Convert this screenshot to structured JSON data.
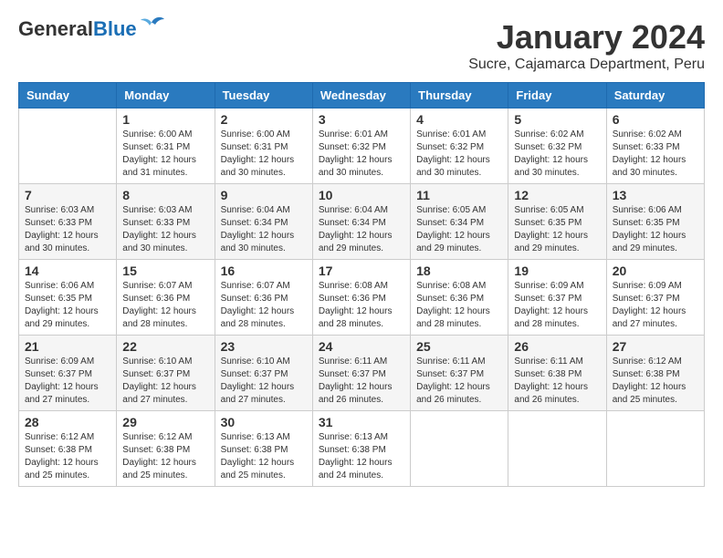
{
  "header": {
    "logo_general": "General",
    "logo_blue": "Blue",
    "month_title": "January 2024",
    "subtitle": "Sucre, Cajamarca Department, Peru"
  },
  "days_of_week": [
    "Sunday",
    "Monday",
    "Tuesday",
    "Wednesday",
    "Thursday",
    "Friday",
    "Saturday"
  ],
  "weeks": [
    [
      {
        "day": "",
        "sunrise": "",
        "sunset": "",
        "daylight": ""
      },
      {
        "day": "1",
        "sunrise": "Sunrise: 6:00 AM",
        "sunset": "Sunset: 6:31 PM",
        "daylight": "Daylight: 12 hours and 31 minutes."
      },
      {
        "day": "2",
        "sunrise": "Sunrise: 6:00 AM",
        "sunset": "Sunset: 6:31 PM",
        "daylight": "Daylight: 12 hours and 30 minutes."
      },
      {
        "day": "3",
        "sunrise": "Sunrise: 6:01 AM",
        "sunset": "Sunset: 6:32 PM",
        "daylight": "Daylight: 12 hours and 30 minutes."
      },
      {
        "day": "4",
        "sunrise": "Sunrise: 6:01 AM",
        "sunset": "Sunset: 6:32 PM",
        "daylight": "Daylight: 12 hours and 30 minutes."
      },
      {
        "day": "5",
        "sunrise": "Sunrise: 6:02 AM",
        "sunset": "Sunset: 6:32 PM",
        "daylight": "Daylight: 12 hours and 30 minutes."
      },
      {
        "day": "6",
        "sunrise": "Sunrise: 6:02 AM",
        "sunset": "Sunset: 6:33 PM",
        "daylight": "Daylight: 12 hours and 30 minutes."
      }
    ],
    [
      {
        "day": "7",
        "sunrise": "Sunrise: 6:03 AM",
        "sunset": "Sunset: 6:33 PM",
        "daylight": "Daylight: 12 hours and 30 minutes."
      },
      {
        "day": "8",
        "sunrise": "Sunrise: 6:03 AM",
        "sunset": "Sunset: 6:33 PM",
        "daylight": "Daylight: 12 hours and 30 minutes."
      },
      {
        "day": "9",
        "sunrise": "Sunrise: 6:04 AM",
        "sunset": "Sunset: 6:34 PM",
        "daylight": "Daylight: 12 hours and 30 minutes."
      },
      {
        "day": "10",
        "sunrise": "Sunrise: 6:04 AM",
        "sunset": "Sunset: 6:34 PM",
        "daylight": "Daylight: 12 hours and 29 minutes."
      },
      {
        "day": "11",
        "sunrise": "Sunrise: 6:05 AM",
        "sunset": "Sunset: 6:34 PM",
        "daylight": "Daylight: 12 hours and 29 minutes."
      },
      {
        "day": "12",
        "sunrise": "Sunrise: 6:05 AM",
        "sunset": "Sunset: 6:35 PM",
        "daylight": "Daylight: 12 hours and 29 minutes."
      },
      {
        "day": "13",
        "sunrise": "Sunrise: 6:06 AM",
        "sunset": "Sunset: 6:35 PM",
        "daylight": "Daylight: 12 hours and 29 minutes."
      }
    ],
    [
      {
        "day": "14",
        "sunrise": "Sunrise: 6:06 AM",
        "sunset": "Sunset: 6:35 PM",
        "daylight": "Daylight: 12 hours and 29 minutes."
      },
      {
        "day": "15",
        "sunrise": "Sunrise: 6:07 AM",
        "sunset": "Sunset: 6:36 PM",
        "daylight": "Daylight: 12 hours and 28 minutes."
      },
      {
        "day": "16",
        "sunrise": "Sunrise: 6:07 AM",
        "sunset": "Sunset: 6:36 PM",
        "daylight": "Daylight: 12 hours and 28 minutes."
      },
      {
        "day": "17",
        "sunrise": "Sunrise: 6:08 AM",
        "sunset": "Sunset: 6:36 PM",
        "daylight": "Daylight: 12 hours and 28 minutes."
      },
      {
        "day": "18",
        "sunrise": "Sunrise: 6:08 AM",
        "sunset": "Sunset: 6:36 PM",
        "daylight": "Daylight: 12 hours and 28 minutes."
      },
      {
        "day": "19",
        "sunrise": "Sunrise: 6:09 AM",
        "sunset": "Sunset: 6:37 PM",
        "daylight": "Daylight: 12 hours and 28 minutes."
      },
      {
        "day": "20",
        "sunrise": "Sunrise: 6:09 AM",
        "sunset": "Sunset: 6:37 PM",
        "daylight": "Daylight: 12 hours and 27 minutes."
      }
    ],
    [
      {
        "day": "21",
        "sunrise": "Sunrise: 6:09 AM",
        "sunset": "Sunset: 6:37 PM",
        "daylight": "Daylight: 12 hours and 27 minutes."
      },
      {
        "day": "22",
        "sunrise": "Sunrise: 6:10 AM",
        "sunset": "Sunset: 6:37 PM",
        "daylight": "Daylight: 12 hours and 27 minutes."
      },
      {
        "day": "23",
        "sunrise": "Sunrise: 6:10 AM",
        "sunset": "Sunset: 6:37 PM",
        "daylight": "Daylight: 12 hours and 27 minutes."
      },
      {
        "day": "24",
        "sunrise": "Sunrise: 6:11 AM",
        "sunset": "Sunset: 6:37 PM",
        "daylight": "Daylight: 12 hours and 26 minutes."
      },
      {
        "day": "25",
        "sunrise": "Sunrise: 6:11 AM",
        "sunset": "Sunset: 6:37 PM",
        "daylight": "Daylight: 12 hours and 26 minutes."
      },
      {
        "day": "26",
        "sunrise": "Sunrise: 6:11 AM",
        "sunset": "Sunset: 6:38 PM",
        "daylight": "Daylight: 12 hours and 26 minutes."
      },
      {
        "day": "27",
        "sunrise": "Sunrise: 6:12 AM",
        "sunset": "Sunset: 6:38 PM",
        "daylight": "Daylight: 12 hours and 25 minutes."
      }
    ],
    [
      {
        "day": "28",
        "sunrise": "Sunrise: 6:12 AM",
        "sunset": "Sunset: 6:38 PM",
        "daylight": "Daylight: 12 hours and 25 minutes."
      },
      {
        "day": "29",
        "sunrise": "Sunrise: 6:12 AM",
        "sunset": "Sunset: 6:38 PM",
        "daylight": "Daylight: 12 hours and 25 minutes."
      },
      {
        "day": "30",
        "sunrise": "Sunrise: 6:13 AM",
        "sunset": "Sunset: 6:38 PM",
        "daylight": "Daylight: 12 hours and 25 minutes."
      },
      {
        "day": "31",
        "sunrise": "Sunrise: 6:13 AM",
        "sunset": "Sunset: 6:38 PM",
        "daylight": "Daylight: 12 hours and 24 minutes."
      },
      {
        "day": "",
        "sunrise": "",
        "sunset": "",
        "daylight": ""
      },
      {
        "day": "",
        "sunrise": "",
        "sunset": "",
        "daylight": ""
      },
      {
        "day": "",
        "sunrise": "",
        "sunset": "",
        "daylight": ""
      }
    ]
  ]
}
